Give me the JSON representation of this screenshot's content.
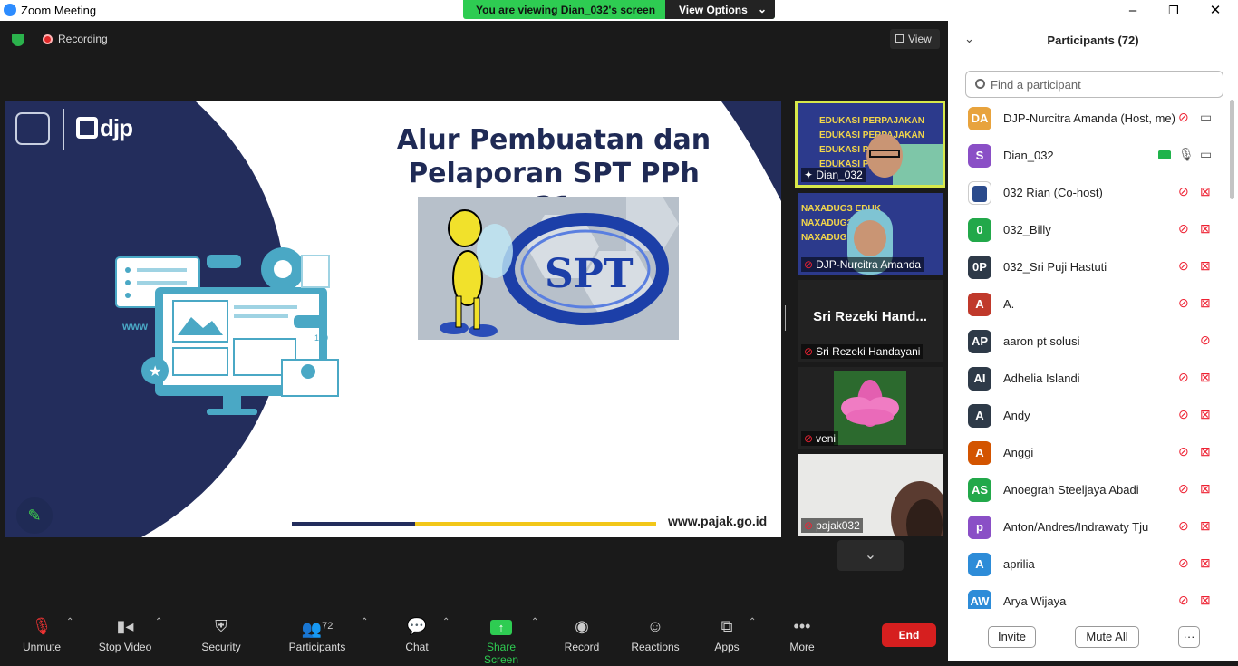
{
  "window": {
    "title": "Zoom Meeting",
    "minimize": "–",
    "maximize": "❐",
    "close": "✕"
  },
  "banner": {
    "message": "You are viewing Dian_032's screen",
    "view_options": "View Options"
  },
  "stage": {
    "recording": "Recording",
    "view": "View"
  },
  "slide": {
    "logo": "djp",
    "title_line1": "Alur Pembuatan dan",
    "title_line2": "Pelaporan SPT PPh 21",
    "image_text": "SPT",
    "url": "www.pajak.go.id",
    "www": "www",
    "badge": "100"
  },
  "tiles": [
    {
      "name": "Dian_032"
    },
    {
      "name": "DJP-Nurcitra Amanda"
    },
    {
      "name": "Sri Rezeki Handayani",
      "big": "Sri Rezeki Hand..."
    },
    {
      "name": "veni"
    },
    {
      "name": "pajak032"
    }
  ],
  "toolbar": {
    "unmute": "Unmute",
    "stop_video": "Stop Video",
    "security": "Security",
    "participants": "Participants",
    "participants_count": "72",
    "chat": "Chat",
    "share_screen": "Share Screen",
    "record": "Record",
    "reactions": "Reactions",
    "apps": "Apps",
    "more": "More",
    "end": "End"
  },
  "panel": {
    "title": "Participants (72)",
    "search_placeholder": "Find a participant",
    "invite": "Invite",
    "mute_all": "Mute All",
    "more": "···"
  },
  "participants": [
    {
      "initials": "DA",
      "name": "DJP-Nurcitra Amanda (Host, me)",
      "color": "#e8a33d"
    },
    {
      "initials": "S",
      "name": "Dian_032",
      "color": "#8a4fc6"
    },
    {
      "initials": "",
      "name": "032 Rian (Co-host)",
      "color": "#ffffff"
    },
    {
      "initials": "0",
      "name": "032_Billy",
      "color": "#22a84a"
    },
    {
      "initials": "0P",
      "name": "032_Sri Puji Hastuti",
      "color": "#2e3a48"
    },
    {
      "initials": "A",
      "name": "A.",
      "color": "#c0392b"
    },
    {
      "initials": "AP",
      "name": "aaron pt solusi",
      "color": "#2e3a48"
    },
    {
      "initials": "AI",
      "name": "Adhelia Islandi",
      "color": "#2e3a48"
    },
    {
      "initials": "A",
      "name": "Andy",
      "color": "#2e3a48"
    },
    {
      "initials": "A",
      "name": "Anggi",
      "color": "#d35400"
    },
    {
      "initials": "AS",
      "name": "Anoegrah Steeljaya Abadi",
      "color": "#22a84a"
    },
    {
      "initials": "p",
      "name": "Anton/Andres/Indrawaty Tju",
      "color": "#8a4fc6"
    },
    {
      "initials": "A",
      "name": "aprilia",
      "color": "#2d8cd8"
    },
    {
      "initials": "AW",
      "name": "Arya Wijaya",
      "color": "#2d8cd8"
    }
  ]
}
